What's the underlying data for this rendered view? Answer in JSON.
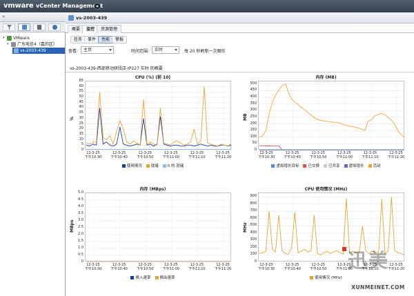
{
  "header": {
    "logo": "vmware",
    "title": "vCenter Management"
  },
  "nav": {
    "collapse": "«",
    "tree": [
      {
        "label": "VMware",
        "level": 0
      },
      {
        "label": "广东电信4（嘉的区）",
        "level": 1
      },
      {
        "label": "vs-2003-439",
        "level": 2,
        "selected": true
      }
    ]
  },
  "vm": {
    "name": "vs-2003-439"
  },
  "tabs": [
    "概要",
    "监控",
    "资源管理"
  ],
  "active_tab": "监控",
  "subtabs": [
    "任务",
    "事件",
    "性能",
    "警报"
  ],
  "active_subtab": "性能",
  "toolbar": {
    "view_label": "查看:",
    "view_value": "主页",
    "range_label": "时间范围:",
    "range_value": "实时",
    "refresh_text": "每 20 秒刷新一次图形"
  },
  "perf_title": "vs-2003-439-西部移动研段店-IP227 实时 的概要",
  "colors": {
    "cpu_blue": "#1f3aa6",
    "cpu_orange": "#e7a535",
    "mem_orange": "#f0a93b",
    "mem_red": "#d9534f"
  },
  "watermark": {
    "text": "迅美",
    "url": "XUNMEINET.COM"
  },
  "chart_data": [
    {
      "type": "line",
      "title": "CPU (%) (前 10)",
      "ylabel": "%",
      "ylim": [
        0,
        65
      ],
      "yticks": [
        "0",
        "5",
        "10",
        "15",
        "20",
        "25",
        "30",
        "35",
        "40",
        "45",
        "50",
        "55",
        "60",
        "65"
      ],
      "x": [
        "12-3-25\n下午10:30",
        "12-3-25\n下午10:40",
        "12-3-25\n下午10:50",
        "12-3-25\n下午11:00",
        "12-3-25\n下午11:10",
        "12-3-25\n下午11:20"
      ],
      "legend": [
        "使用情况",
        "就绪",
        "0 的 就绪"
      ],
      "series": [
        {
          "name": "使用情况",
          "color": "#1f3aa6",
          "values": [
            5,
            4,
            6,
            5,
            40,
            6,
            8,
            5,
            4,
            6,
            22,
            6,
            5,
            4,
            5,
            6,
            5,
            30,
            5,
            6,
            4,
            6,
            32,
            6,
            5,
            4,
            5,
            5,
            4,
            4,
            5,
            5,
            4,
            5,
            6,
            5,
            4,
            5,
            4,
            4,
            5,
            5,
            4,
            5
          ]
        },
        {
          "name": "就绪",
          "color": "#e7a535",
          "values": [
            7,
            6,
            8,
            8,
            55,
            12,
            10,
            14,
            6,
            18,
            28,
            20,
            8,
            6,
            9,
            7,
            5,
            48,
            6,
            8,
            6,
            5,
            40,
            7,
            6,
            5,
            8,
            9,
            7,
            5,
            6,
            8,
            20,
            6,
            9,
            60,
            7,
            6,
            5,
            4,
            6,
            5,
            4,
            6
          ]
        },
        {
          "name": "0 的 就绪",
          "color": "#8fb8e6",
          "values": [
            1,
            1,
            1,
            1,
            1,
            1,
            1,
            1,
            1,
            1,
            1,
            1,
            1,
            1,
            1,
            1,
            1,
            1,
            1,
            1,
            1,
            1,
            1,
            1,
            1,
            1,
            1,
            1,
            1,
            1,
            1,
            1,
            1,
            1,
            1,
            1,
            1,
            1,
            1,
            1,
            1,
            1,
            1,
            1
          ]
        }
      ]
    },
    {
      "type": "line",
      "title": "内存 (MB)",
      "ylabel": "MB",
      "ylim": [
        0,
        520
      ],
      "yticks": [
        "0",
        "50",
        "100",
        "150",
        "200",
        "250",
        "300",
        "350",
        "400",
        "450",
        "500"
      ],
      "x": [
        "12-3-25\n下午10:30",
        "12-3-25\n下午10:40",
        "12-3-25\n下午10:50",
        "12-3-25\n下午11:00",
        "12-3-25\n下午11:10",
        "12-3-25\n下午11:20"
      ],
      "legend": [
        "虚拟增长目标",
        "已交换",
        "已共享",
        "虚拟增长",
        "活动"
      ],
      "series": [
        {
          "name": "活动",
          "color": "#f0a93b",
          "values": [
            100,
            110,
            150,
            280,
            370,
            420,
            460,
            490,
            500,
            420,
            380,
            360,
            340,
            320,
            300,
            280,
            260,
            240,
            230,
            225,
            220,
            218,
            215,
            212,
            210,
            200,
            190,
            185,
            180,
            175,
            170,
            160,
            150,
            220,
            230,
            260,
            270,
            280,
            270,
            250,
            230,
            200,
            150,
            120,
            100
          ]
        },
        {
          "name": "已交换",
          "color": "#d9534f",
          "values": [
            35,
            35,
            34,
            34,
            33,
            33,
            33,
            0,
            0,
            0,
            0,
            0,
            0,
            0,
            0,
            0,
            0,
            0,
            0,
            0,
            0,
            0,
            0,
            0,
            0,
            0,
            0,
            0,
            0,
            0,
            0,
            0,
            0,
            0,
            0,
            0,
            0,
            0,
            0,
            0,
            0,
            0,
            0,
            0,
            0
          ]
        },
        {
          "name": "虚拟增长",
          "color": "#6a7fc6",
          "values": [
            2,
            2,
            2,
            2,
            2,
            2,
            2,
            2,
            2,
            2,
            2,
            2,
            2,
            2,
            2,
            2,
            2,
            2,
            2,
            2,
            2,
            2,
            2,
            2,
            2,
            2,
            2,
            2,
            2,
            2,
            2,
            2,
            2,
            2,
            2,
            2,
            2,
            2,
            2,
            2,
            2,
            2,
            2,
            2,
            2
          ]
        }
      ]
    },
    {
      "type": "line",
      "title": "内存 (MBps)",
      "ylabel": "MBps",
      "ylim": [
        0,
        5
      ],
      "yticks": [
        "0",
        "0.5",
        "1.0",
        "1.5",
        "2.0",
        "2.5",
        "3.0",
        "3.5",
        "4.0",
        "4.5",
        "5.0"
      ],
      "x": [
        "12-3-25\n下午10:30",
        "12-3-25\n下午10:40",
        "12-3-25\n下午10:50",
        "12-3-25\n下午11:00",
        "12-3-25\n下午11:10",
        "12-3-25\n下午11:20"
      ],
      "legend": [
        "换入速率",
        "换出速率"
      ],
      "series": [
        {
          "name": "换入速率",
          "color": "#1f3aa6",
          "values": [
            0,
            0,
            0,
            0,
            0,
            0,
            0,
            0,
            0,
            0,
            0,
            0,
            0,
            0,
            0,
            0,
            0,
            0,
            0,
            0,
            0,
            0,
            0,
            0,
            0,
            0,
            0,
            0,
            0,
            0
          ]
        },
        {
          "name": "换出速率",
          "color": "#e7a535",
          "values": [
            0,
            0,
            0,
            0,
            0,
            0,
            0,
            0,
            0,
            0,
            0,
            0,
            0,
            0,
            0,
            0,
            0,
            0,
            0,
            0,
            0,
            0,
            0,
            0,
            0,
            0,
            0,
            0,
            0,
            0
          ]
        }
      ]
    },
    {
      "type": "line",
      "title": "CPU 使用情况 (MHz)",
      "ylabel": "MHz",
      "ylim": [
        0,
        950
      ],
      "yticks": [
        "0",
        "100",
        "200",
        "300",
        "400",
        "500",
        "600",
        "700",
        "800",
        "900"
      ],
      "x": [
        "12-3-25\n下午10:30",
        "12-3-25\n下午10:40",
        "12-3-25\n下午10:50",
        "12-3-25\n下午11:00",
        "12-3-25\n下午11:10",
        "12-3-25\n下午11:20"
      ],
      "legend": [
        "使用情况 (MHz)"
      ],
      "series": [
        {
          "name": "使用情况 (MHz)",
          "color": "#e7a535",
          "values": [
            120,
            130,
            150,
            700,
            180,
            140,
            650,
            160,
            120,
            110,
            200,
            690,
            130,
            150,
            180,
            140,
            160,
            650,
            120,
            100,
            130,
            150,
            120,
            140,
            160,
            130,
            110,
            880,
            120,
            150,
            130,
            140,
            500,
            160,
            120,
            150,
            140,
            130,
            870,
            120,
            150,
            900,
            160,
            130,
            120,
            100
          ]
        }
      ]
    }
  ]
}
